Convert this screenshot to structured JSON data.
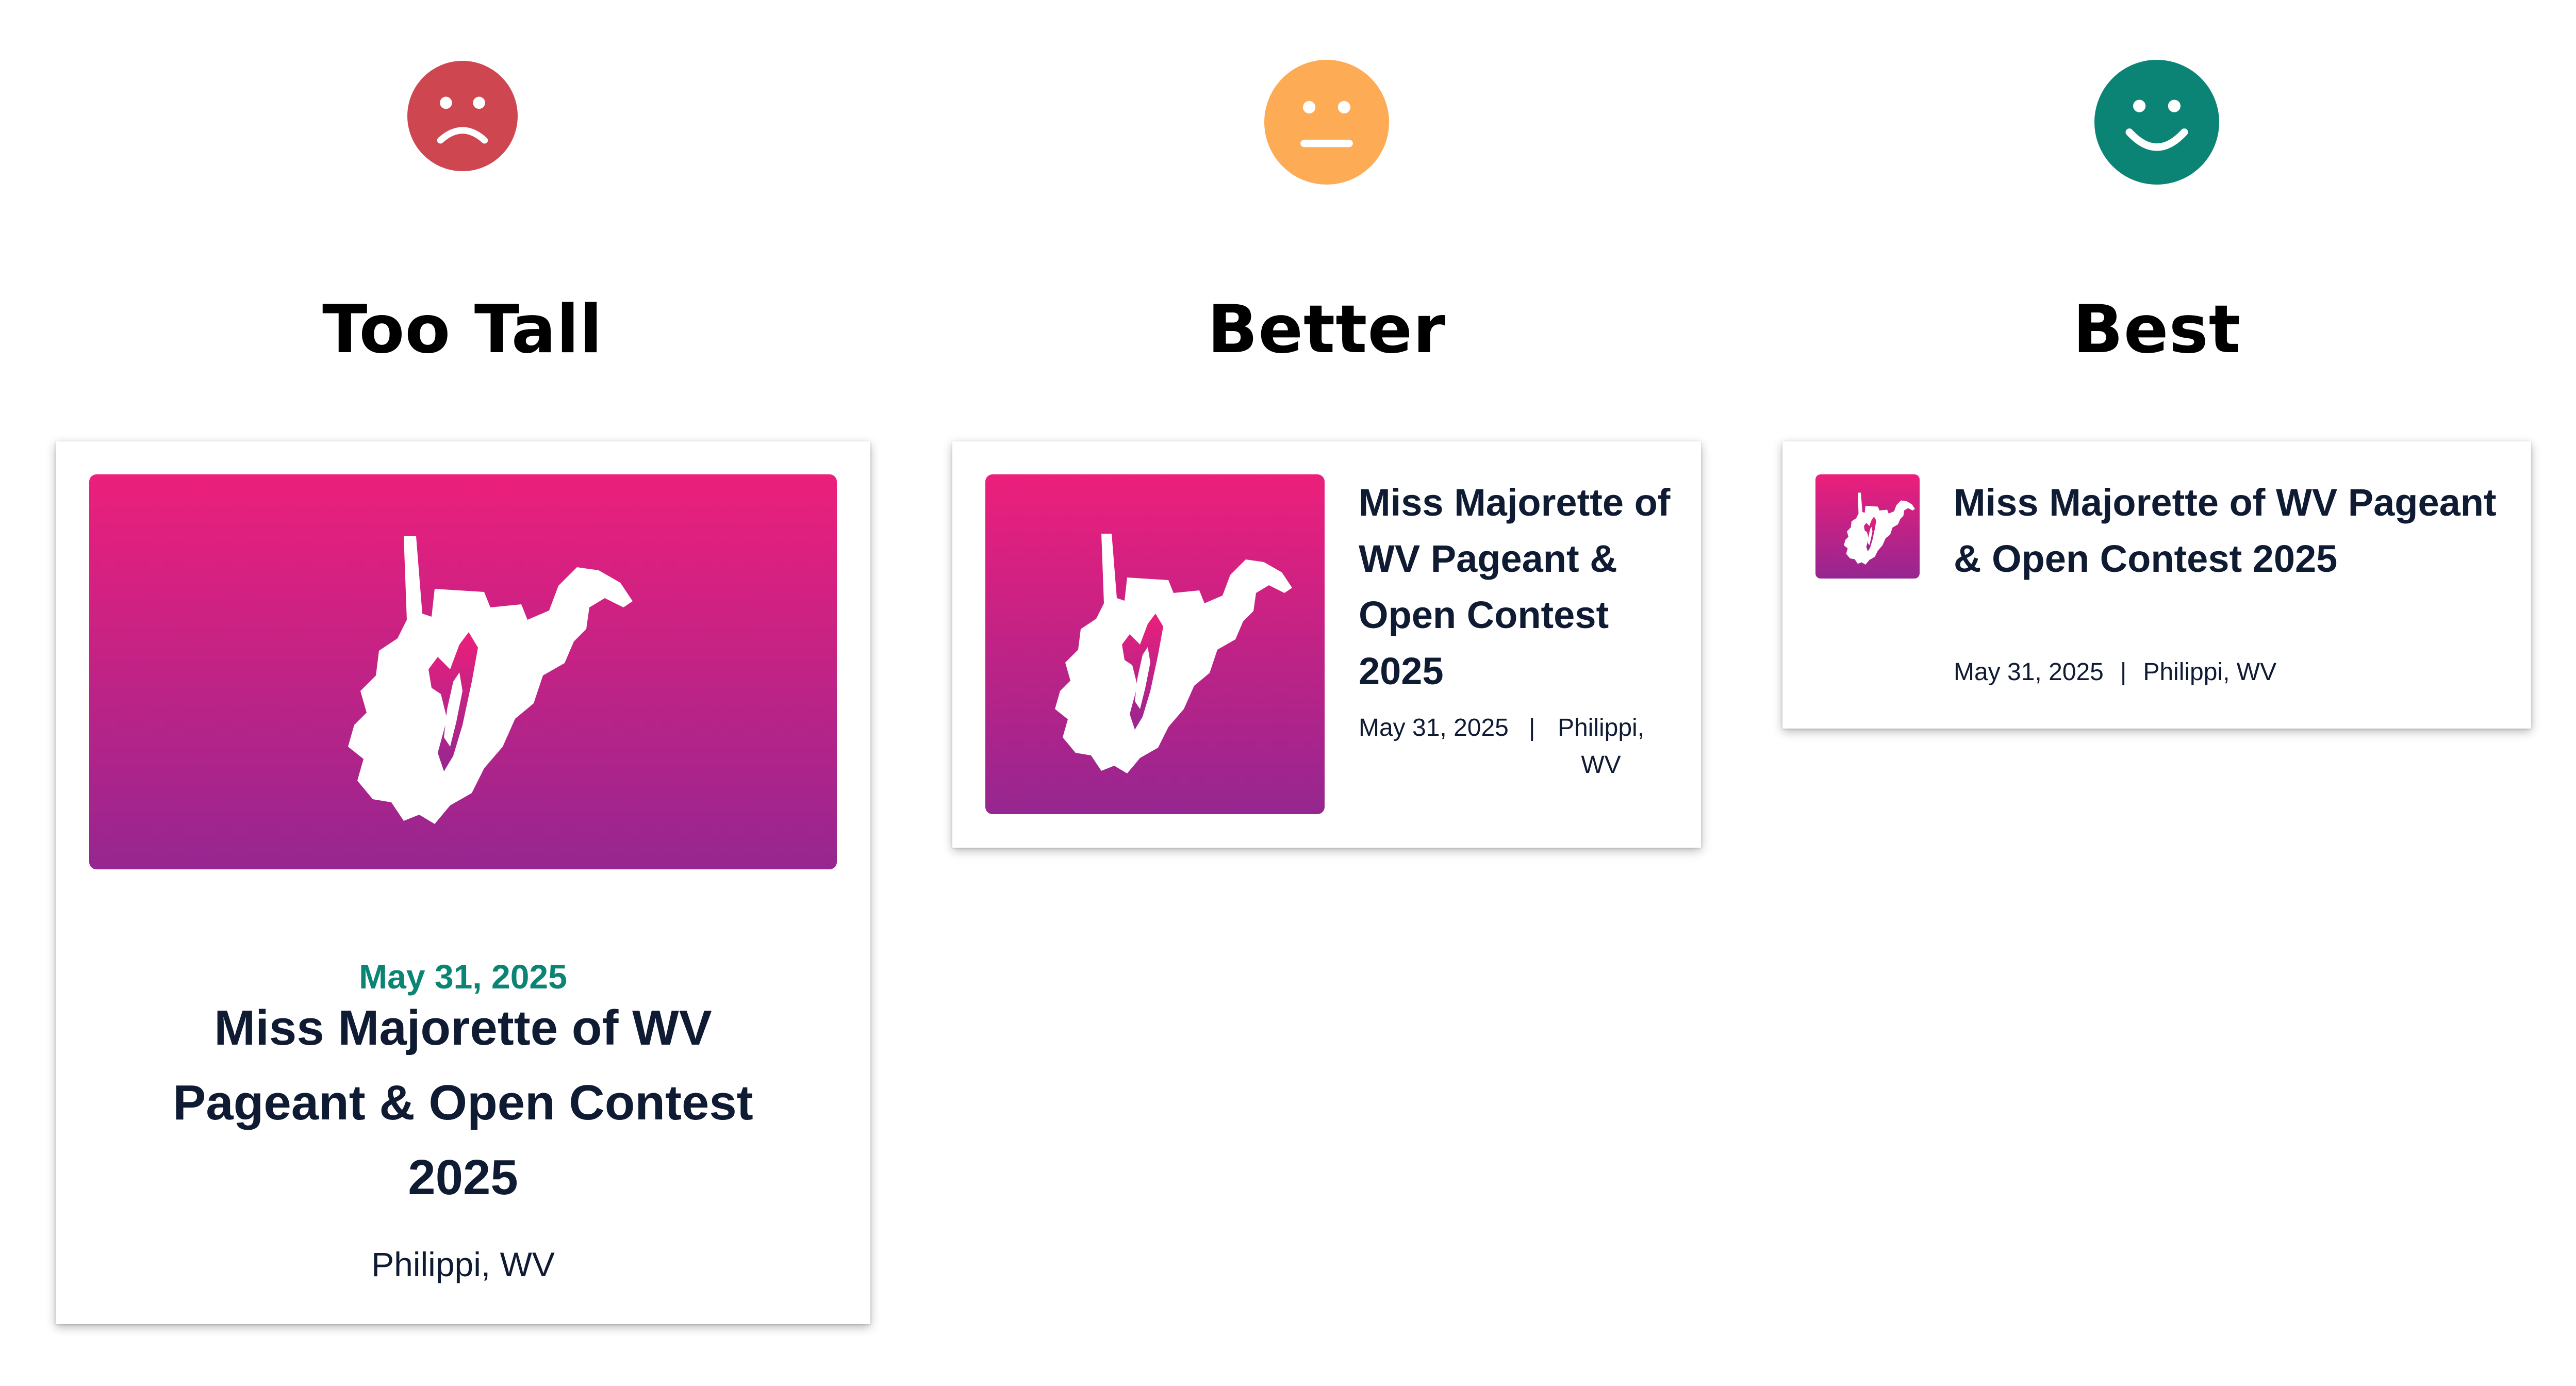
{
  "colors": {
    "sad_face": "#ce4650",
    "neutral_face": "#fdab55",
    "happy_face": "#0b8475",
    "gradient_top": "#ec1f7b",
    "gradient_bottom": "#962690",
    "date_accent": "#0a8473",
    "text_dark": "#0f1b33"
  },
  "columns": [
    {
      "face_icon": "sad-face-icon",
      "title": "Too Tall",
      "card": {
        "date": "May 31, 2025",
        "title": "Miss Majorette of WV Pageant & Open Contest 2025",
        "location": "Philippi, WV"
      }
    },
    {
      "face_icon": "neutral-face-icon",
      "title": "Better",
      "card": {
        "title": "Miss Majorette of WV Pageant & Open Contest 2025",
        "date": "May 31, 2025",
        "separator": "|",
        "location": "Philippi, WV"
      }
    },
    {
      "face_icon": "happy-face-icon",
      "title": "Best",
      "card": {
        "title": "Miss Majorette of WV Pageant & Open Contest 2025",
        "date": "May 31, 2025",
        "separator": "|",
        "location": "Philippi, WV"
      }
    }
  ]
}
